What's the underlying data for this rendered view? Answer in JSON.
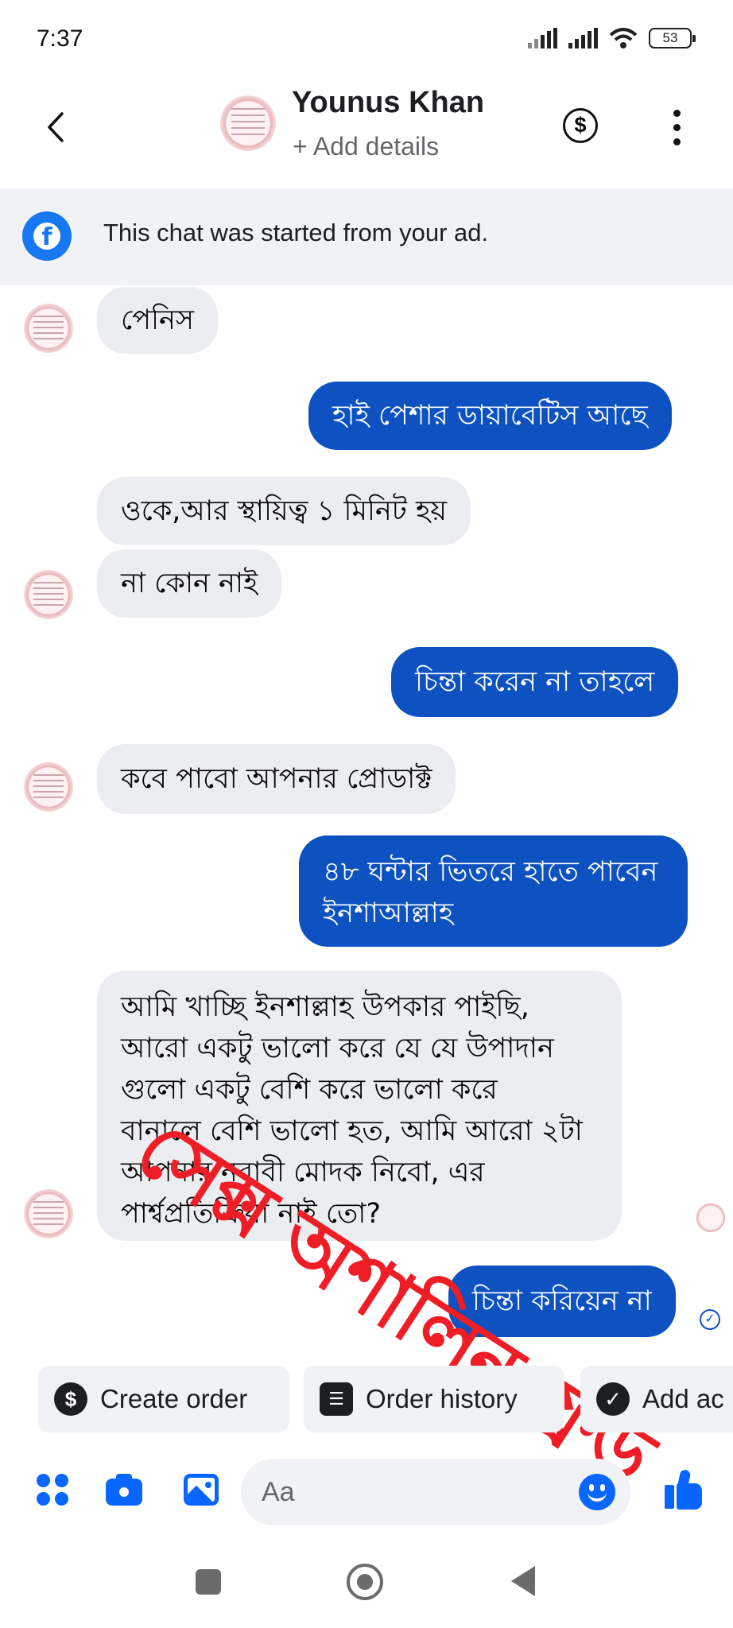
{
  "status_bar": {
    "time": "7:37",
    "battery": "53"
  },
  "header": {
    "name": "Younus Khan",
    "subtitle": "+ Add details"
  },
  "banner": {
    "text": "This chat was started from your ad."
  },
  "messages": [
    {
      "dir": "in",
      "text": "পেনিস"
    },
    {
      "dir": "out",
      "text": "হাই পেশার ডায়াবেটিস আছে"
    },
    {
      "dir": "in",
      "text": "ওকে,আর স্থায়িত্ব ১ মিনিট হয়"
    },
    {
      "dir": "in",
      "text": "না কোন নাই"
    },
    {
      "dir": "out",
      "text": "চিন্তা করেন না তাহলে"
    },
    {
      "dir": "in",
      "text": "কবে পাবো আপনার প্রোডাক্ট"
    },
    {
      "dir": "out",
      "lines": [
        "৪৮ ঘন্টার ভিতরে হাতে পাবেন",
        "ইনশাআল্লাহ"
      ]
    },
    {
      "dir": "in",
      "lines": [
        "আমি খাচ্ছি ইনশাল্লাহ উপকার পাইছি,",
        "আরো একটু ভালো করে    যে যে উপাদান",
        "গুলো একটু বেশি করে ভালো করে",
        "বানালে বেশি ভালো হত, আমি আরো ২টা",
        "আপনার নবাবী মোদক নিবো, এর",
        "পার্শ্বপ্রতিক্রিয়া নাই তো?"
      ]
    },
    {
      "dir": "out",
      "text": "চিন্তা করিয়েন না"
    }
  ],
  "watermark": "সেক্স অশালিন ফ্রড",
  "quick_actions": [
    {
      "label": "Create order",
      "icon": "dollar-icon"
    },
    {
      "label": "Order history",
      "icon": "list-icon"
    },
    {
      "label": "Add ac",
      "icon": "check-icon"
    }
  ],
  "composer": {
    "placeholder": "Aa"
  }
}
